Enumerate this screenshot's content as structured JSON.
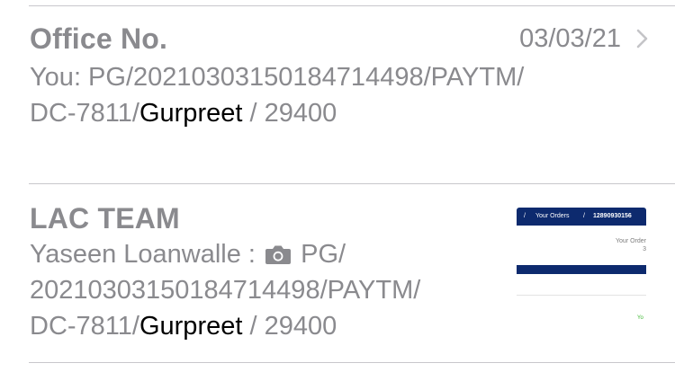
{
  "messages": [
    {
      "sender": "Office No.",
      "date": "03/03/21",
      "preview_lines": [
        {
          "pre": "You: PG/202103031501847144​98/PAYTM/",
          "name": "",
          "post": ""
        },
        {
          "pre": "DC-7811/",
          "name": "Gurpreet",
          "post": " / 29400"
        }
      ]
    },
    {
      "sender": "LAC TEAM",
      "line1_pre": "Yaseen Loanwalle : ",
      "line1_post": " PG/",
      "line2": "20210303150184714498/PAYTM/",
      "line3_pre": "DC-7811/",
      "line3_name": "Gurpreet",
      "line3_post": " / 29400",
      "attachment_icon": "camera-icon",
      "thumbnail": {
        "bar_sep1": "/",
        "bar_title": "Your Orders",
        "bar_sep2": "/",
        "bar_order": "12890930156",
        "body_line1": "Your Order",
        "body_line2": "3",
        "green_text": "Yo"
      }
    }
  ],
  "colors": {
    "secondary_text": "#8a8a8e",
    "highlight_text": "#000000",
    "thumbnail_navy": "#0d2a6e",
    "separator": "#c8c7cc"
  }
}
